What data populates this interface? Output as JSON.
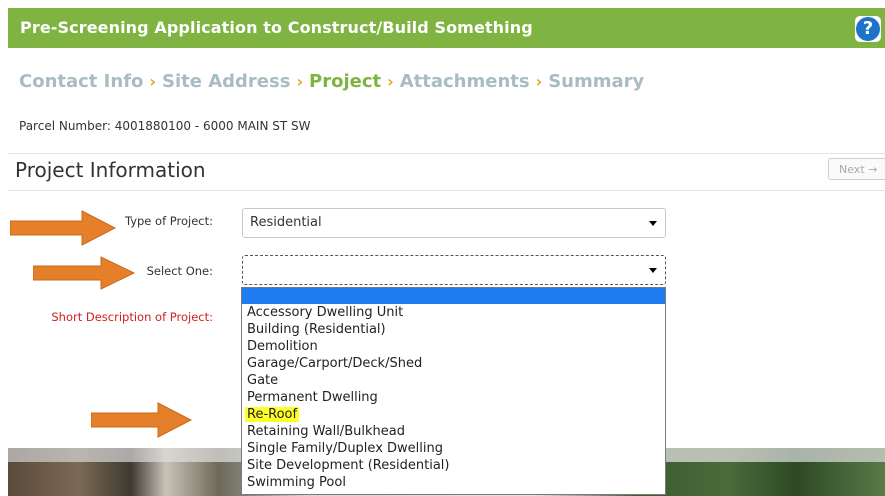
{
  "header": {
    "title": "Pre-Screening Application to Construct/Build Something",
    "help_icon": "?"
  },
  "steps": [
    {
      "label": "Contact Info",
      "active": false
    },
    {
      "label": "Site Address",
      "active": false
    },
    {
      "label": "Project",
      "active": true
    },
    {
      "label": "Attachments",
      "active": false
    },
    {
      "label": "Summary",
      "active": false
    }
  ],
  "step_separator": "›",
  "parcel": "Parcel Number: 4001880100 - 6000 MAIN ST SW",
  "section": {
    "title": "Project Information",
    "next_label": "Next →"
  },
  "form": {
    "type_label": "Type of Project:",
    "type_value": "Residential",
    "select_label": "Select One:",
    "select_value": "",
    "description_label": "Short Description of Project:"
  },
  "dropdown_options": [
    "",
    "Accessory Dwelling Unit",
    "Building (Residential)",
    "Demolition",
    "Garage/Carport/Deck/Shed",
    "Gate",
    "Permanent Dwelling",
    "Re-Roof",
    "Retaining Wall/Bulkhead",
    "Single Family/Duplex Dwelling",
    "Site Development (Residential)",
    "Swimming Pool"
  ],
  "highlighted_option": "Re-Roof",
  "colors": {
    "header": "#7fb342",
    "arrow": "#e57f2a",
    "highlight": "#ffff2a",
    "selected_blank": "#1e7bf0"
  }
}
